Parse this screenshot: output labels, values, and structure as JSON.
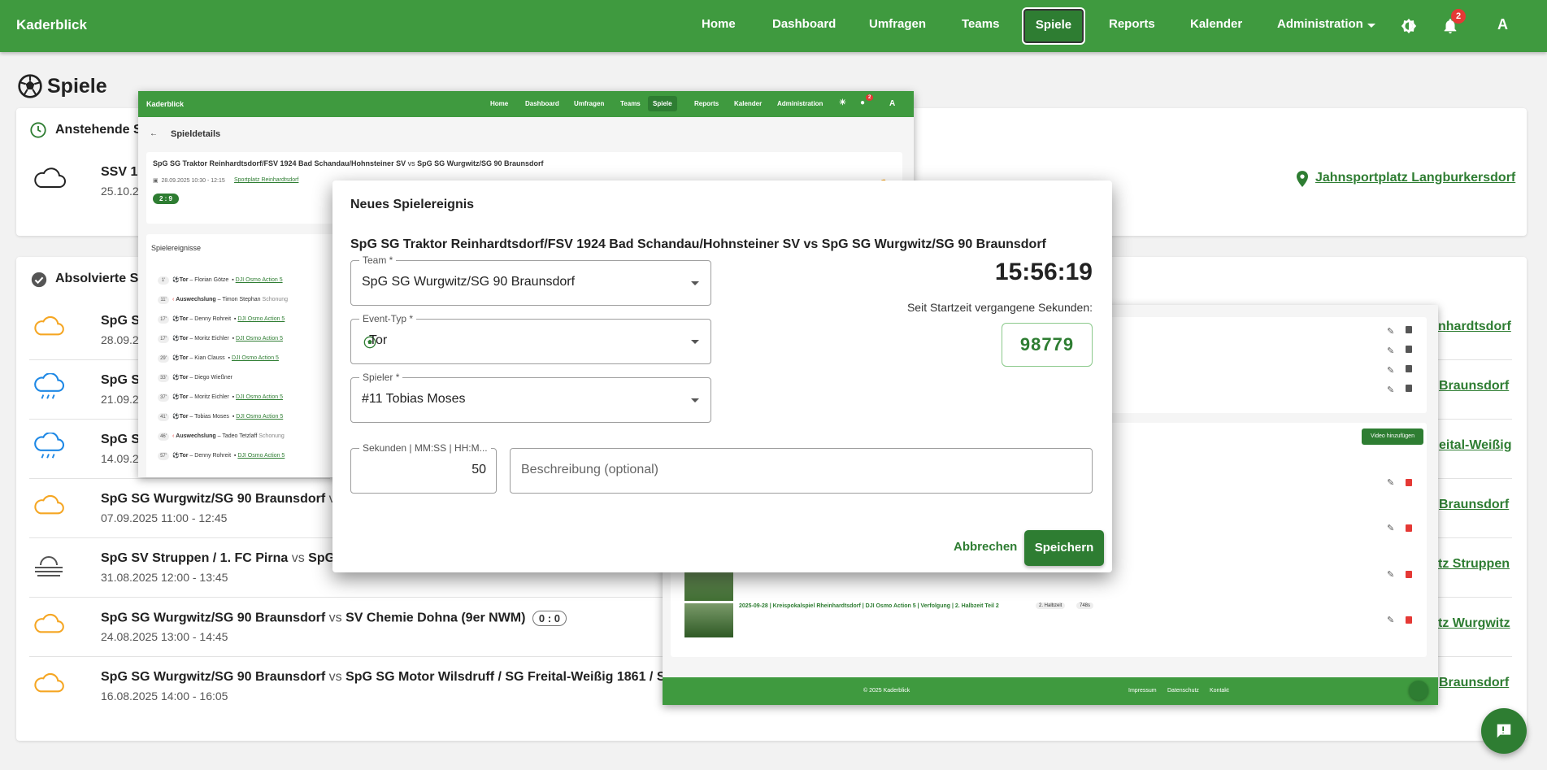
{
  "app": {
    "brand": "Kaderblick"
  },
  "nav": {
    "items": [
      "Home",
      "Dashboard",
      "Umfragen",
      "Teams",
      "Spiele",
      "Reports",
      "Kalender",
      "Administration"
    ],
    "notification_count": "2",
    "avatar_letter": "A"
  },
  "page": {
    "title": "Spiele"
  },
  "upcoming": {
    "title": "Anstehende Sp",
    "games": [
      {
        "home": "SSV 18",
        "date": "25.10.2",
        "venue": "Jahnsportplatz Langburkersdorf",
        "weather": "cloud-outline"
      }
    ]
  },
  "played": {
    "title": "Absolvierte Sp",
    "games": [
      {
        "title": "SpG S",
        "date": "28.09.2",
        "weather": "cloud-sun",
        "venue": "nhardtsdorf"
      },
      {
        "title": "SpG S",
        "date": "21.09.2",
        "weather": "cloud-rain",
        "venue": "Braunsdorf"
      },
      {
        "title": "SpG S",
        "date": "14.09.2",
        "weather": "cloud-rain",
        "venue": "eital-Weißig"
      },
      {
        "home": "SpG SG Wurgwitz/SG 90 Braunsdorf",
        "vs": "vs",
        "date": "07.09.2025 11:00 - 12:45",
        "weather": "cloud-sun",
        "venue": "Braunsdorf"
      },
      {
        "home": "SpG SV Struppen / 1. FC Pirna",
        "vs": "vs",
        "away": "SpG S",
        "date": "31.08.2025 12:00 - 13:45",
        "weather": "fog",
        "venue": "tz Struppen"
      },
      {
        "home": "SpG SG Wurgwitz/SG 90 Braunsdorf",
        "vs": "vs",
        "away": "SV Chemie Dohna (9er NWM)",
        "score": "0 : 0",
        "date": "24.08.2025 13:00 - 14:45",
        "weather": "cloud-sun",
        "venue": "tz Wurgwitz"
      },
      {
        "home": "SpG SG Wurgwitz/SG 90 Braunsdorf",
        "vs": "vs",
        "away": "SpG SG Motor Wilsdruff / SG Freital-Weißig 1861 / SG I",
        "date": "16.08.2025 14:00 - 16:05",
        "weather": "cloud-sun",
        "venue": "Braunsdorf"
      }
    ]
  },
  "mini_details": {
    "brand": "Kaderblick",
    "nav": [
      "Home",
      "Dashboard",
      "Umfragen",
      "Teams",
      "Spiele",
      "Reports",
      "Kalender",
      "Administration"
    ],
    "badge": "2",
    "avatar": "A",
    "title": "Spieldetails",
    "match_home": "SpG SG Traktor Reinhardtsdorf/FSV 1924 Bad Schandau/Hohnsteiner SV",
    "match_vs": "vs",
    "match_away": "SpG SG Wurgwitz/SG 90 Braunsdorf",
    "date": "28.09.2025 10:30 - 12:15",
    "venue": "Sportplatz Reinhardtsdorf",
    "score": "2 : 9",
    "events_title": "Spielereignisse",
    "events": [
      {
        "min": "1'",
        "type": "Tor",
        "player": "Florian Götze",
        "video": "DJI Osmo Action 5"
      },
      {
        "min": "11'",
        "type": "Auswechslung",
        "player": "Timon Stephan",
        "note": "Schonung"
      },
      {
        "min": "17'",
        "type": "Tor",
        "player": "Denny Rohreit",
        "video": "DJI Osmo Action 5"
      },
      {
        "min": "17'",
        "type": "Tor",
        "player": "Moritz Eichler",
        "video": "DJI Osmo Action 5"
      },
      {
        "min": "29'",
        "type": "Tor",
        "player": "Kian Clauss",
        "video": "DJI Osmo Action 5"
      },
      {
        "min": "33'",
        "type": "Tor",
        "player": "Diego Wießner",
        "video": ""
      },
      {
        "min": "37'",
        "type": "Tor",
        "player": "Moritz Eichler",
        "video": "DJI Osmo Action 5"
      },
      {
        "min": "41'",
        "type": "Tor",
        "player": "Tobias Moses",
        "video": "DJI Osmo Action 5"
      },
      {
        "min": "46'",
        "type": "Auswechslung",
        "player": "Tadeo Tetzlaff",
        "note": "Schonung"
      },
      {
        "min": "57'",
        "type": "Tor",
        "player": "Denny Rohreit",
        "video": "DJI Osmo Action 5"
      }
    ]
  },
  "mini_videos": {
    "add_video": "Video hinzufügen",
    "video_title": "2025-09-28 | Kreispokalspiel Rheinhardtsdorf | DJI Osmo Action 5 | Verfolgung | 2. Halbzeit Teil 2",
    "video_tag": "2. Halbzeit",
    "video_len": "748s",
    "footer_copy": "© 2025 Kaderblick",
    "footer_links": [
      "Impressum",
      "Datenschutz",
      "Kontakt"
    ]
  },
  "dialog": {
    "title": "Neues Spielereignis",
    "match": "SpG SG Traktor Reinhardtsdorf/FSV 1924 Bad Schandau/Hohnsteiner SV vs SpG SG Wurgwitz/SG 90 Braunsdorf",
    "team_label": "Team *",
    "team_value": "SpG SG Wurgwitz/SG 90 Braunsdorf",
    "event_label": "Event-Typ *",
    "event_value": "Tor",
    "player_label": "Spieler *",
    "player_value": "#11 Tobias Moses",
    "clock": "15:56:19",
    "elapsed_label": "Seit Startzeit vergangene Sekunden:",
    "elapsed_value": "98779",
    "seconds_label": "Sekunden | MM:SS | HH:M...",
    "seconds_value": "50",
    "description_placeholder": "Beschreibung (optional)",
    "cancel": "Abbrechen",
    "save": "Speichern"
  },
  "colors": {
    "primary": "#3f9a3f",
    "primary_dark": "#2e7d32",
    "danger": "#e53935",
    "sun": "#f5a623",
    "rain": "#1e88e5"
  }
}
